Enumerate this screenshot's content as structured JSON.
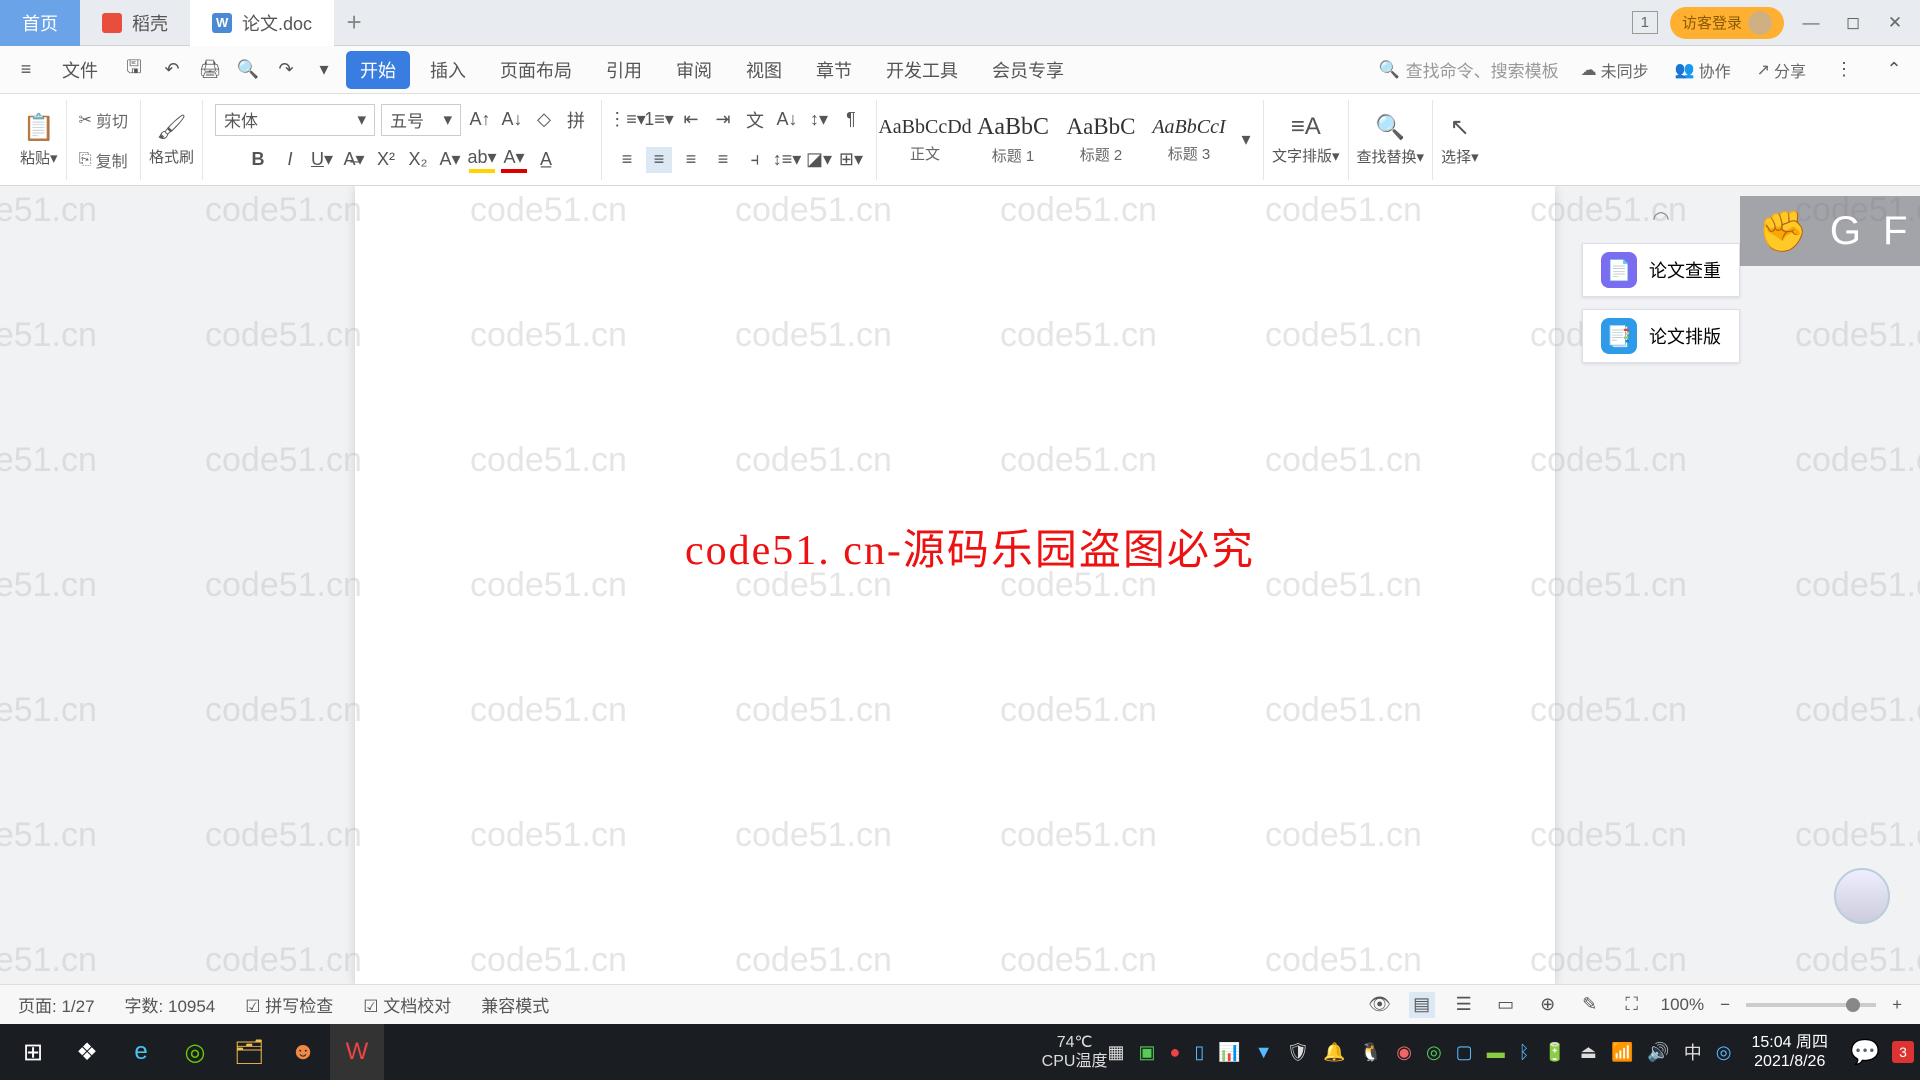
{
  "titleBar": {
    "tabs": [
      {
        "label": "首页"
      },
      {
        "label": "稻壳"
      },
      {
        "label": "论文.doc"
      }
    ],
    "badge": "1",
    "login": "访客登录"
  },
  "menu": {
    "file": "文件",
    "tabs": [
      "开始",
      "插入",
      "页面布局",
      "引用",
      "审阅",
      "视图",
      "章节",
      "开发工具",
      "会员专享"
    ],
    "search_ph": "查找命令、搜索模板",
    "unsync": "未同步",
    "collab": "协作",
    "share": "分享"
  },
  "ribbon": {
    "paste": "粘贴",
    "cut": "剪切",
    "copy": "复制",
    "brush": "格式刷",
    "font_name": "宋体",
    "font_size": "五号",
    "styles": [
      {
        "prev": "AaBbCcDd",
        "name": "正文"
      },
      {
        "prev": "AaBbC",
        "name": "标题 1"
      },
      {
        "prev": "AaBbC",
        "name": "标题 2"
      },
      {
        "prev": "AaBbCcI",
        "name": "标题 3"
      }
    ],
    "textlayout": "文字排版",
    "findreplace": "查找替换",
    "select": "选择"
  },
  "document": {
    "center_text": "code51. cn-源码乐园盗图必究",
    "watermark": "code51.cn",
    "side": [
      {
        "label": "论文查重",
        "color": "#7a6df0"
      },
      {
        "label": "论文排版",
        "color": "#2f9be8"
      }
    ]
  },
  "status": {
    "page": "页面: 1/27",
    "words": "字数: 10954",
    "spell": "拼写检查",
    "doccheck": "文档校对",
    "compat": "兼容模式",
    "zoom": "100%"
  },
  "taskbar": {
    "cpu": "74℃",
    "cpu_label": "CPU温度",
    "time": "15:04 周四",
    "date": "2021/8/26",
    "ime": "中"
  }
}
